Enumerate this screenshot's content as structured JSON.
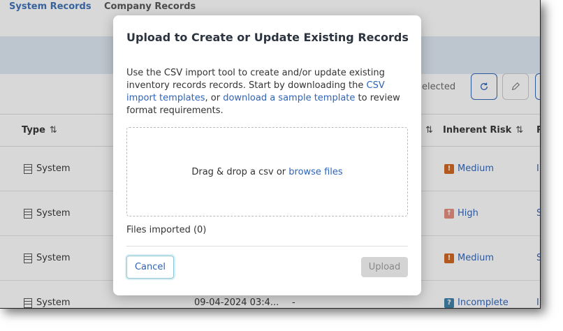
{
  "tabs": {
    "system_records": "System Records",
    "company_records": "Company Records"
  },
  "toolbar": {
    "selected_text": "elected"
  },
  "table": {
    "headers": {
      "type": "Type",
      "inherent_risk": "Inherent Risk",
      "next_col": "R",
      "sort_icon": "⇅"
    },
    "rows": [
      {
        "type": "System",
        "date": "",
        "dash": "",
        "risk": "Medium",
        "risk_icon": "!",
        "risk_color": "#d4641c",
        "next": "I"
      },
      {
        "type": "System",
        "date": "",
        "dash": "",
        "risk": "High",
        "risk_icon": "↑",
        "risk_color": "#e88c7c",
        "next": "S"
      },
      {
        "type": "System",
        "date": "",
        "dash": "",
        "risk": "Medium",
        "risk_icon": "!",
        "risk_color": "#d4641c",
        "next": "S"
      },
      {
        "type": "System",
        "date": "09-04-2024 03:4...",
        "dash": "-",
        "risk": "Incomplete",
        "risk_icon": "?",
        "risk_color": "#3a7fa8",
        "next": "I"
      }
    ]
  },
  "modal": {
    "title": "Upload to Create or Update Existing Records",
    "desc_part1": "Use the CSV import tool to create and/or update existing inventory records records. Start by downloading the ",
    "desc_link1": "CSV import templates",
    "desc_part2": ", or ",
    "desc_link2": "download a sample template",
    "desc_part3": " to review format requirements.",
    "drop_text": "Drag & drop a csv or ",
    "browse_link": "browse files",
    "files_imported": "Files imported (0)",
    "cancel_label": "Cancel",
    "upload_label": "Upload"
  },
  "colors": {
    "accent": "#2e63b8",
    "header_band": "#dfe8f3"
  }
}
